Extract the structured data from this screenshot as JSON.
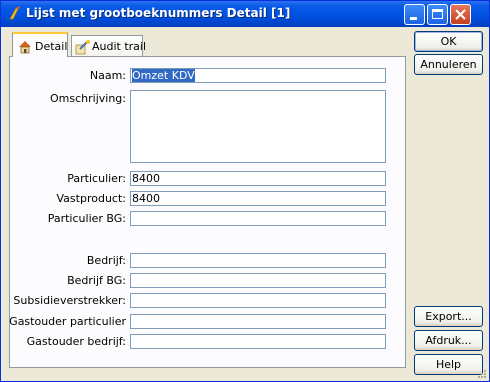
{
  "window": {
    "title": "Lijst met grootboeknummers Detail [1]"
  },
  "tabs": [
    {
      "label": "Detail",
      "icon": "house-icon"
    },
    {
      "label": "Audit trail",
      "icon": "key-audit-icon"
    }
  ],
  "form": {
    "naam": {
      "label": "Naam:",
      "value": "Omzet KDV"
    },
    "omschrijving": {
      "label": "Omschrijving:",
      "value": ""
    },
    "particulier": {
      "label": "Particulier:",
      "value": "8400"
    },
    "vastproduct": {
      "label": "Vastproduct:",
      "value": "8400"
    },
    "particulier_bg": {
      "label": "Particulier BG:",
      "value": ""
    },
    "bedrijf": {
      "label": "Bedrijf:",
      "value": ""
    },
    "bedrijf_bg": {
      "label": "Bedrijf BG:",
      "value": ""
    },
    "subsidieverstrekker": {
      "label": "Subsidieverstrekker:",
      "value": ""
    },
    "gastouder_particulier": {
      "label": "Gastouder particulier",
      "value": ""
    },
    "gastouder_bedrijf": {
      "label": "Gastouder bedrijf:",
      "value": ""
    }
  },
  "buttons": {
    "ok": "OK",
    "cancel": "Annuleren",
    "export": "Export...",
    "print": "Afdruk...",
    "help": "Help"
  },
  "colors": {
    "titlebar": "#0054e3",
    "selection": "#316ac5",
    "dialog": "#ece9d8"
  }
}
